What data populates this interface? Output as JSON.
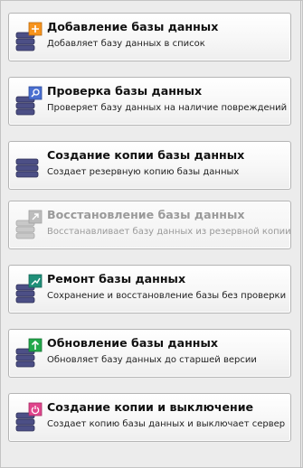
{
  "actions": [
    {
      "id": "add",
      "title": "Добавление базы данных",
      "desc": "Добавляет базу данных в список",
      "icon": "database-add-icon",
      "badge_color": "#f7941d",
      "enabled": true
    },
    {
      "id": "check",
      "title": "Проверка базы данных",
      "desc": "Проверяет базу данных на наличие повреждений",
      "icon": "database-check-icon",
      "badge_color": "#4a6fd0",
      "enabled": true
    },
    {
      "id": "backup",
      "title": "Создание копии базы данных",
      "desc": "Создает резервную копию базы данных",
      "icon": "database-backup-icon",
      "badge_color": "",
      "enabled": true
    },
    {
      "id": "restore",
      "title": "Восстановление базы данных",
      "desc": "Восстанавливает базу данных из резервной копии",
      "icon": "database-restore-icon",
      "badge_color": "#bdbdbd",
      "enabled": false
    },
    {
      "id": "repair",
      "title": "Ремонт базы данных",
      "desc": "Сохранение и восстановление базы без проверки",
      "icon": "database-repair-icon",
      "badge_color": "#1f8f78",
      "enabled": true
    },
    {
      "id": "update",
      "title": "Обновление базы данных",
      "desc": "Обновляет базу данных до старшей версии",
      "icon": "database-update-icon",
      "badge_color": "#22a84a",
      "enabled": true
    },
    {
      "id": "backup-shutdown",
      "title": "Создание копии и выключение",
      "desc": "Создает копию базы данных и выключает сервер",
      "icon": "database-shutdown-icon",
      "badge_color": "#e0458c",
      "enabled": true
    }
  ]
}
